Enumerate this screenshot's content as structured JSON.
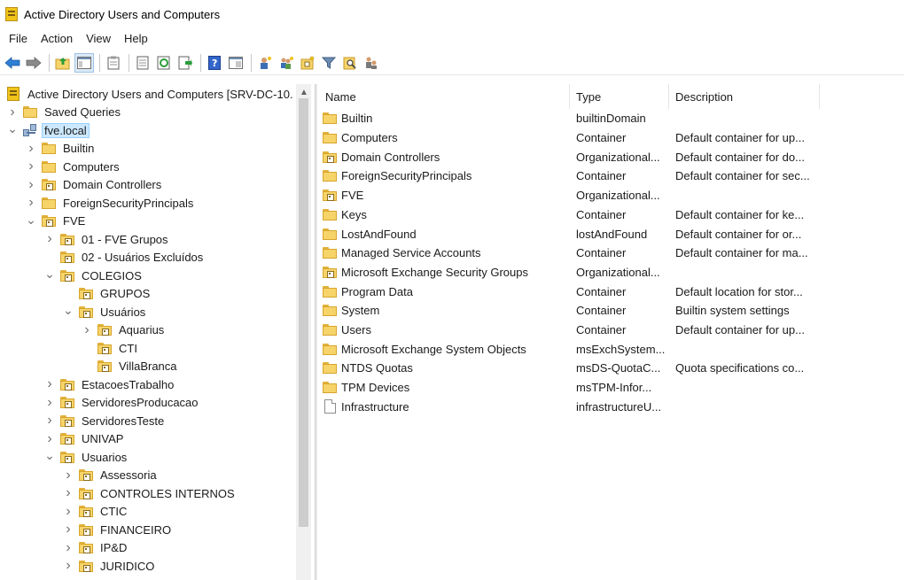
{
  "window": {
    "title": "Active Directory Users and Computers"
  },
  "menu": [
    "File",
    "Action",
    "View",
    "Help"
  ],
  "toolbar": {
    "buttons": [
      "back-arrow-icon",
      "forward-arrow-icon",
      "up-folder-icon",
      "show-tree-icon",
      "clipboard-icon",
      "properties-icon",
      "refresh-icon",
      "export-list-icon",
      "help-icon",
      "console-icon",
      "add-user-icon",
      "add-group-icon",
      "add-ou-icon",
      "filter-icon",
      "find-icon",
      "delegate-icon"
    ]
  },
  "tree": {
    "root": "Active Directory Users and Computers [SRV-DC-10.",
    "items": [
      {
        "label": "Saved Queries",
        "level": 1,
        "expander": "collapsed",
        "icon": "folder"
      },
      {
        "label": "fve.local",
        "level": 1,
        "expander": "expanded",
        "icon": "domain",
        "selected": true
      },
      {
        "label": "Builtin",
        "level": 2,
        "expander": "collapsed",
        "icon": "folder"
      },
      {
        "label": "Computers",
        "level": 2,
        "expander": "collapsed",
        "icon": "folder"
      },
      {
        "label": "Domain Controllers",
        "level": 2,
        "expander": "collapsed",
        "icon": "ou"
      },
      {
        "label": "ForeignSecurityPrincipals",
        "level": 2,
        "expander": "collapsed",
        "icon": "folder"
      },
      {
        "label": "FVE",
        "level": 2,
        "expander": "expanded",
        "icon": "ou"
      },
      {
        "label": "01 - FVE Grupos",
        "level": 3,
        "expander": "collapsed",
        "icon": "ou"
      },
      {
        "label": "02 - Usuários Excluídos",
        "level": 3,
        "expander": "none",
        "icon": "ou"
      },
      {
        "label": "COLEGIOS",
        "level": 3,
        "expander": "expanded",
        "icon": "ou"
      },
      {
        "label": "GRUPOS",
        "level": 4,
        "expander": "none",
        "icon": "ou"
      },
      {
        "label": "Usuários",
        "level": 4,
        "expander": "expanded",
        "icon": "ou"
      },
      {
        "label": "Aquarius",
        "level": 5,
        "expander": "collapsed",
        "icon": "ou"
      },
      {
        "label": "CTI",
        "level": 5,
        "expander": "none",
        "icon": "ou"
      },
      {
        "label": "VillaBranca",
        "level": 5,
        "expander": "none",
        "icon": "ou"
      },
      {
        "label": "EstacoesTrabalho",
        "level": 3,
        "expander": "collapsed",
        "icon": "ou"
      },
      {
        "label": "ServidoresProducacao",
        "level": 3,
        "expander": "collapsed",
        "icon": "ou"
      },
      {
        "label": "ServidoresTeste",
        "level": 3,
        "expander": "collapsed",
        "icon": "ou"
      },
      {
        "label": "UNIVAP",
        "level": 3,
        "expander": "collapsed",
        "icon": "ou"
      },
      {
        "label": "Usuarios",
        "level": 3,
        "expander": "expanded",
        "icon": "ou"
      },
      {
        "label": "Assessoria",
        "level": 4,
        "expander": "collapsed",
        "icon": "ou"
      },
      {
        "label": "CONTROLES INTERNOS",
        "level": 4,
        "expander": "collapsed",
        "icon": "ou"
      },
      {
        "label": "CTIC",
        "level": 4,
        "expander": "collapsed",
        "icon": "ou"
      },
      {
        "label": "FINANCEIRO",
        "level": 4,
        "expander": "collapsed",
        "icon": "ou"
      },
      {
        "label": "IP&D",
        "level": 4,
        "expander": "collapsed",
        "icon": "ou"
      },
      {
        "label": "JURIDICO",
        "level": 4,
        "expander": "collapsed",
        "icon": "ou"
      }
    ]
  },
  "list": {
    "columns": [
      "Name",
      "Type",
      "Description"
    ],
    "rows": [
      {
        "name": "Builtin",
        "type": "builtinDomain",
        "description": "",
        "icon": "folder"
      },
      {
        "name": "Computers",
        "type": "Container",
        "description": "Default container for up...",
        "icon": "folder"
      },
      {
        "name": "Domain Controllers",
        "type": "Organizational...",
        "description": "Default container for do...",
        "icon": "ou"
      },
      {
        "name": "ForeignSecurityPrincipals",
        "type": "Container",
        "description": "Default container for sec...",
        "icon": "folder"
      },
      {
        "name": "FVE",
        "type": "Organizational...",
        "description": "",
        "icon": "ou"
      },
      {
        "name": "Keys",
        "type": "Container",
        "description": "Default container for ke...",
        "icon": "folder"
      },
      {
        "name": "LostAndFound",
        "type": "lostAndFound",
        "description": "Default container for or...",
        "icon": "folder"
      },
      {
        "name": "Managed Service Accounts",
        "type": "Container",
        "description": "Default container for ma...",
        "icon": "folder"
      },
      {
        "name": "Microsoft Exchange Security Groups",
        "type": "Organizational...",
        "description": "",
        "icon": "ou"
      },
      {
        "name": "Program Data",
        "type": "Container",
        "description": "Default location for stor...",
        "icon": "folder"
      },
      {
        "name": "System",
        "type": "Container",
        "description": "Builtin system settings",
        "icon": "folder"
      },
      {
        "name": "Users",
        "type": "Container",
        "description": "Default container for up...",
        "icon": "folder"
      },
      {
        "name": "Microsoft Exchange System Objects",
        "type": "msExchSystem...",
        "description": "",
        "icon": "folder"
      },
      {
        "name": "NTDS Quotas",
        "type": "msDS-QuotaC...",
        "description": "Quota specifications co...",
        "icon": "folder"
      },
      {
        "name": "TPM Devices",
        "type": "msTPM-Infor...",
        "description": "",
        "icon": "folder"
      },
      {
        "name": "Infrastructure",
        "type": "infrastructureU...",
        "description": "",
        "icon": "file"
      }
    ]
  }
}
